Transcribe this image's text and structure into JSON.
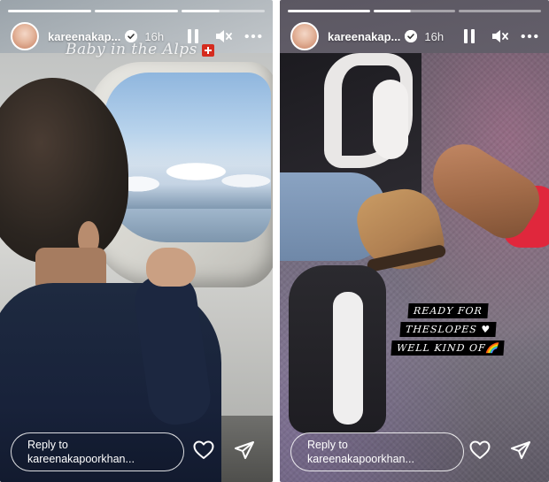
{
  "stories": [
    {
      "username": "kareenakap...",
      "time": "16h",
      "caption": "Baby in the Alps",
      "reply_placeholder_line1": "Reply to",
      "reply_placeholder_line2": "kareenakapoorkhan...",
      "progress_segments": 3,
      "active_segment": 3
    },
    {
      "username": "kareenakap...",
      "time": "16h",
      "sticker_lines": [
        "READY FOR",
        "THESLOPES ♥",
        "WELL KIND OF🌈"
      ],
      "reply_placeholder_line1": "Reply to",
      "reply_placeholder_line2": "kareenakapoorkhan...",
      "progress_segments": 3,
      "active_segment": 2
    }
  ],
  "icons": {
    "verified": "verified-badge-icon",
    "pause": "pause-icon",
    "mute": "speaker-muted-icon",
    "more": "more-options-icon",
    "like": "heart-icon",
    "share": "send-paper-plane-icon"
  },
  "colors": {
    "overlay_text": "#ffffff",
    "sticker_bg": "#000000",
    "flag_red": "#d52b1e"
  }
}
